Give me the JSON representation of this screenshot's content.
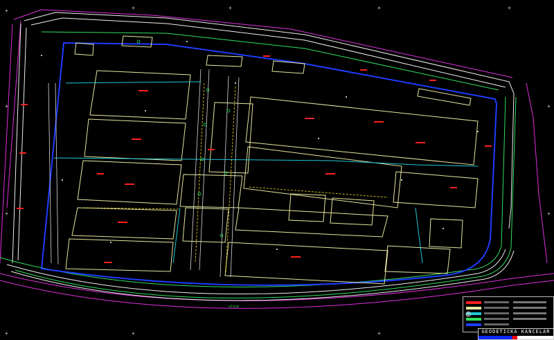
{
  "drawing": {
    "title_block_text": "GEODETICKÁ KANCELÁŘ",
    "street_label": "ulice",
    "colors": {
      "background": "#000000",
      "boundary": "#1e3cff",
      "buildings": "#e6e6a0",
      "roads_white": "#f0f0f0",
      "curbs_green": "#30e060",
      "cadastre_magenta": "#e030e0",
      "annotations_red": "#ff2020",
      "fences_cyan": "#20c8d8",
      "utilities_yellow": "#f0e020",
      "points_white": "#ffffff"
    }
  },
  "legend": {
    "icon": "north-arrow-icon"
  }
}
